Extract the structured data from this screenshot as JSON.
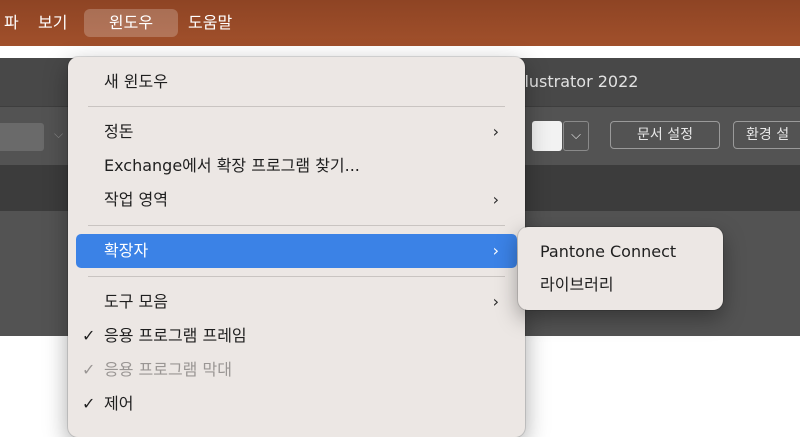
{
  "menubar": {
    "items": [
      {
        "label": "파"
      },
      {
        "label": "보기"
      },
      {
        "label": "윈도우"
      },
      {
        "label": "도움말"
      }
    ],
    "active_index": 2,
    "color": "#99492a"
  },
  "app": {
    "title": "llustrator 2022"
  },
  "controlbar": {
    "color_dropdown_icon": "chevron-down-icon",
    "document_setup_label": "문서 설정",
    "preferences_label": "환경 설"
  },
  "window_menu": {
    "items": [
      {
        "label": "새 윈도우",
        "submenu": false,
        "checked": false,
        "disabled": false
      },
      {
        "label": "정돈",
        "submenu": true,
        "checked": false,
        "disabled": false
      },
      {
        "label": "Exchange에서 확장 프로그램 찾기...",
        "submenu": false,
        "checked": false,
        "disabled": false
      },
      {
        "label": "작업 영역",
        "submenu": true,
        "checked": false,
        "disabled": false
      },
      {
        "label": "확장자",
        "submenu": true,
        "checked": false,
        "disabled": false,
        "highlighted": true
      },
      {
        "label": "도구 모음",
        "submenu": true,
        "checked": false,
        "disabled": false
      },
      {
        "label": "응용 프로그램 프레임",
        "submenu": false,
        "checked": true,
        "disabled": false
      },
      {
        "label": "응용 프로그램 막대",
        "submenu": false,
        "checked": true,
        "disabled": true
      },
      {
        "label": "제어",
        "submenu": false,
        "checked": true,
        "disabled": false
      }
    ],
    "chevron": "›",
    "checkmark": "✓",
    "highlight_color": "#3b82e6"
  },
  "extensions_submenu": {
    "items": [
      {
        "label": "Pantone Connect"
      },
      {
        "label": "라이브러리"
      }
    ]
  }
}
